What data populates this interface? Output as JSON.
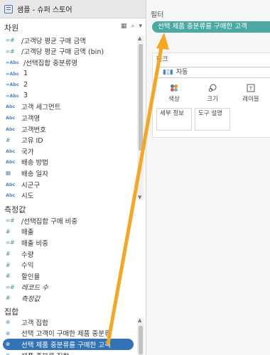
{
  "datasource": {
    "title": "샘플 - 슈퍼 스토어"
  },
  "dimensions": {
    "title": "차원",
    "items": [
      {
        "icon": "=#",
        "label": "/고객당 평균 구매 금액"
      },
      {
        "icon": "=#",
        "label": "/고객당 평균 구매 금액 (bin)"
      },
      {
        "icon": "=Abc",
        "label": "/선택집합 중분류명"
      },
      {
        "icon": "=Abc",
        "label": "1"
      },
      {
        "icon": "=Abc",
        "label": "2"
      },
      {
        "icon": "=Abc",
        "label": "3"
      },
      {
        "icon": "Abc",
        "label": "고객 세그먼트"
      },
      {
        "icon": "Abc",
        "label": "고객명"
      },
      {
        "icon": "Abc",
        "label": "고객번호"
      },
      {
        "icon": "#",
        "label": "고유 ID"
      },
      {
        "icon": "Abc",
        "label": "국가"
      },
      {
        "icon": "Abc",
        "label": "배송 방법"
      },
      {
        "icon": "cal",
        "label": "배송 일자"
      },
      {
        "icon": "Abc",
        "label": "시군구"
      },
      {
        "icon": "Abc",
        "label": "시도"
      }
    ]
  },
  "measures": {
    "title": "측정값",
    "items": [
      {
        "icon": "=#",
        "label": "/선택집합 구매 비중"
      },
      {
        "icon": "#",
        "label": "매출"
      },
      {
        "icon": "=#",
        "label": "매출 비중"
      },
      {
        "icon": "#",
        "label": "수량"
      },
      {
        "icon": "#",
        "label": "수익"
      },
      {
        "icon": "#",
        "label": "할인율"
      },
      {
        "icon": "=#",
        "label": "레코드 수"
      },
      {
        "icon": "#",
        "label": "측정값"
      }
    ]
  },
  "sets": {
    "title": "집합",
    "items": [
      {
        "label": "고객 집합"
      },
      {
        "label": "선택 고객이 구매한 제품 중분류"
      },
      {
        "label": "선택 제품 중분류를 구매한 고객"
      },
      {
        "label": "제품 중분류 집합"
      }
    ]
  },
  "filters": {
    "title": "필터",
    "pill": "선택 제품 중분류를 구매한 고객"
  },
  "marks": {
    "title": "마크",
    "type": "자동",
    "cards": [
      "색상",
      "크기",
      "레이블"
    ],
    "boxes": [
      "세부 정보",
      "도구 설명"
    ]
  },
  "colors": {
    "filter_pill": "#4aa9a1",
    "selected_pill": "#3173b5",
    "arrow": "#f5a623"
  }
}
